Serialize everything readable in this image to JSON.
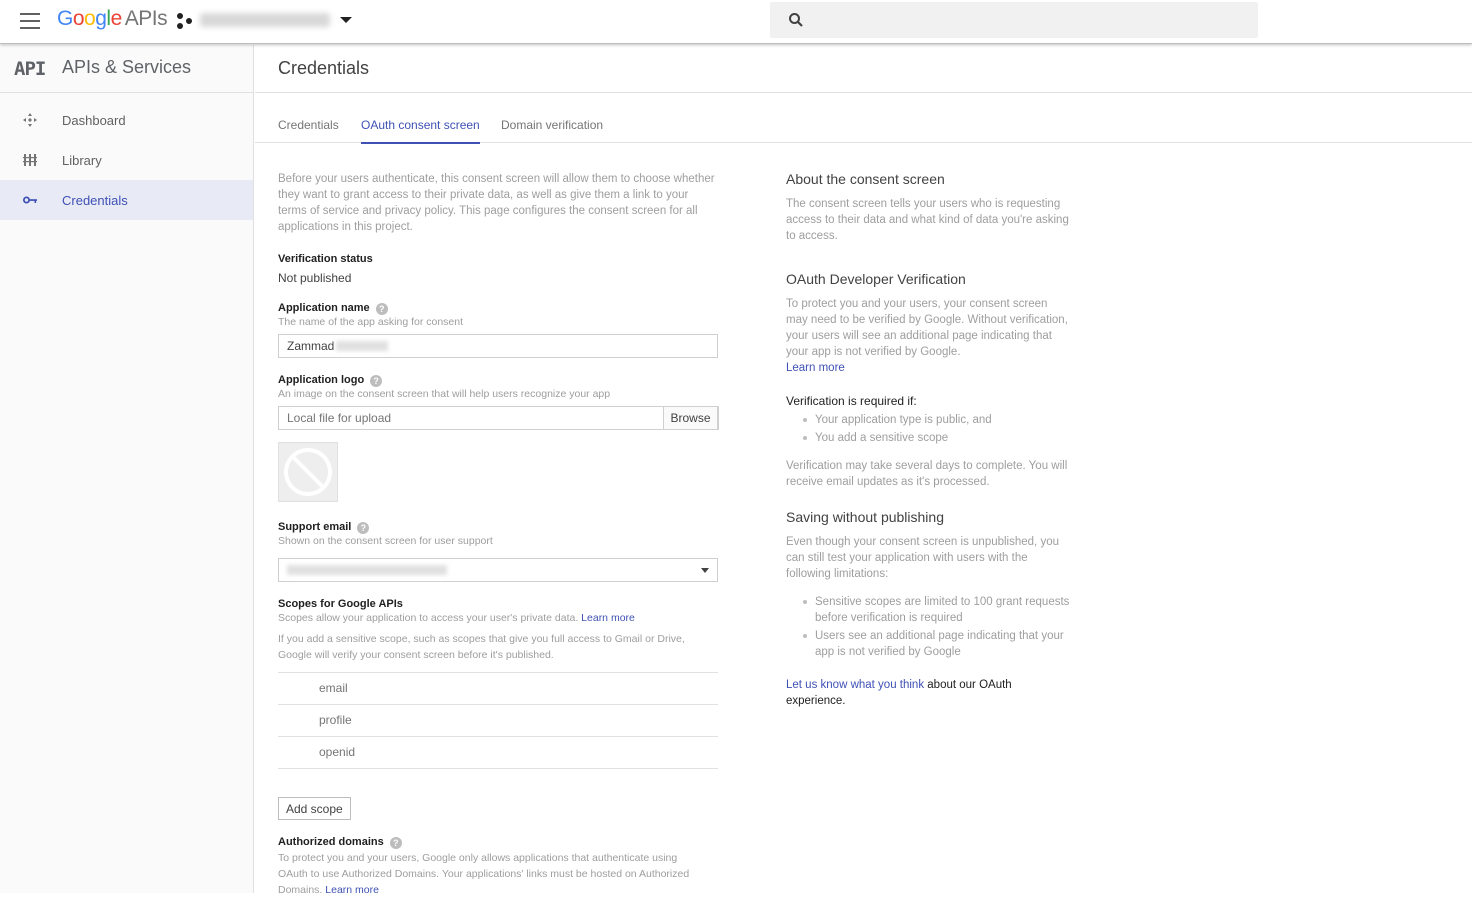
{
  "header": {
    "logo_google": "Google",
    "logo_apis": "APIs",
    "search_placeholder": ""
  },
  "sidebar": {
    "api_mark": "API",
    "title": "APIs & Services",
    "items": [
      {
        "label": "Dashboard",
        "icon": "dashboard-icon"
      },
      {
        "label": "Library",
        "icon": "library-icon"
      },
      {
        "label": "Credentials",
        "icon": "key-icon",
        "active": true
      }
    ]
  },
  "page": {
    "title": "Credentials",
    "tabs": [
      {
        "label": "Credentials"
      },
      {
        "label": "OAuth consent screen",
        "active": true
      },
      {
        "label": "Domain verification"
      }
    ]
  },
  "form": {
    "intro": "Before your users authenticate, this consent screen will allow them to choose whether they want to grant access to their private data, as well as give them a link to your terms of service and privacy policy. This page configures the consent screen for all applications in this project.",
    "verification_status_label": "Verification status",
    "verification_status_value": "Not published",
    "app_name_label": "Application name",
    "app_name_hint": "The name of the app asking for consent",
    "app_name_value": "Zammad",
    "app_logo_label": "Application logo",
    "app_logo_hint": "An image on the consent screen that will help users recognize your app",
    "app_logo_placeholder": "Local file for upload",
    "browse_label": "Browse",
    "support_email_label": "Support email",
    "support_email_hint": "Shown on the consent screen for user support",
    "scopes_label": "Scopes for Google APIs",
    "scopes_hint": "Scopes allow your application to access your user's private data.",
    "scopes_learn_more": "Learn more",
    "scopes_note": "If you add a sensitive scope, such as scopes that give you full access to Gmail or Drive, Google will verify your consent screen before it's published.",
    "scopes": [
      "email",
      "profile",
      "openid"
    ],
    "add_scope_label": "Add scope",
    "domains_label": "Authorized domains",
    "domains_hint": "To protect you and your users, Google only allows applications that authenticate using OAuth to use Authorized Domains. Your applications' links must be hosted on Authorized Domains.",
    "domains_learn_more": "Learn more"
  },
  "info": {
    "about_title": "About the consent screen",
    "about_text": "The consent screen tells your users who is requesting access to their data and what kind of data you're asking to access.",
    "dev_title": "OAuth Developer Verification",
    "dev_text": "To protect you and your users, your consent screen may need to be verified by Google. Without verification, your users will see an additional page indicating that your app is not verified by Google.",
    "dev_learn_more": "Learn more",
    "required_title": "Verification is required if:",
    "required_items": [
      "Your application type is public, and",
      "You add a sensitive scope"
    ],
    "days_text": "Verification may take several days to complete. You will receive email updates as it's processed.",
    "saving_title": "Saving without publishing",
    "saving_text": "Even though your consent screen is unpublished, you can still test your application with users with the following limitations:",
    "saving_items": [
      "Sensitive scopes are limited to 100 grant requests before verification is required",
      "Users see an additional page indicating that your app is not verified by Google"
    ],
    "feedback_link": "Let us know what you think",
    "feedback_text": " about our OAuth experience."
  },
  "colors": {
    "accent": "#3f51b5",
    "active_bg": "#e8eaf6"
  }
}
